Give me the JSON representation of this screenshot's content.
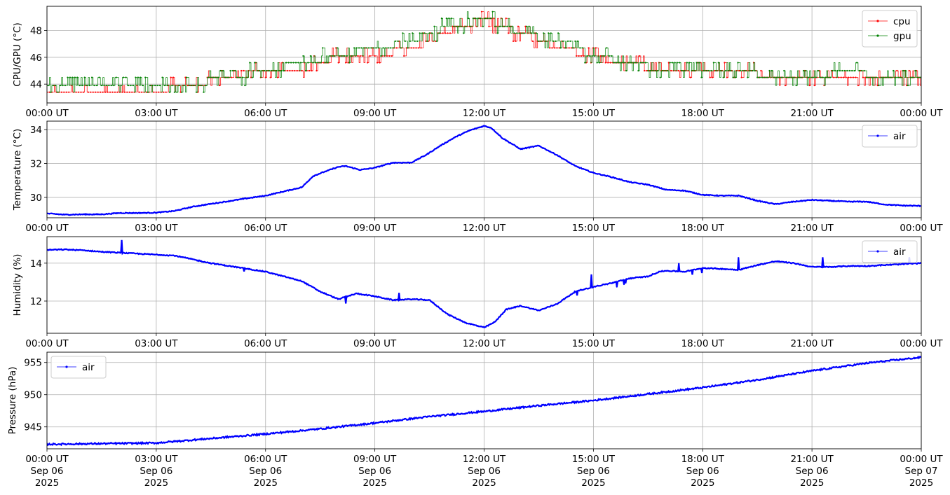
{
  "chart_data": [
    {
      "type": "line",
      "ylabel": "CPU/GPU (°C)",
      "ylim": [
        42.6,
        49.8
      ],
      "yticks": [
        "44",
        "46",
        "48"
      ],
      "xticks": [
        "00:00 UT",
        "03:00 UT",
        "06:00 UT",
        "09:00 UT",
        "12:00 UT",
        "15:00 UT",
        "18:00 UT",
        "21:00 UT",
        "00:00 UT"
      ],
      "grid": true,
      "legend_position": "top-right",
      "x_hours": [
        0,
        1,
        2,
        3,
        4,
        5,
        6,
        7,
        8,
        9,
        10,
        11,
        12,
        13,
        14,
        15,
        16,
        17,
        18,
        19,
        20,
        21,
        22,
        23,
        24
      ],
      "series": [
        {
          "name": "cpu",
          "color": "#ff0000",
          "values": [
            43.4,
            43.4,
            43.5,
            43.5,
            44.0,
            44.5,
            45.0,
            45.0,
            46.1,
            46.1,
            46.7,
            47.8,
            48.8,
            47.8,
            46.7,
            46.1,
            45.5,
            45.0,
            45.0,
            45.0,
            44.5,
            44.5,
            44.5,
            44.5,
            44.5
          ]
        },
        {
          "name": "gpu",
          "color": "#008000",
          "values": [
            44.0,
            44.0,
            44.0,
            44.0,
            44.0,
            44.5,
            45.0,
            45.6,
            46.1,
            46.7,
            47.2,
            48.3,
            48.9,
            47.8,
            47.2,
            46.1,
            45.6,
            45.0,
            45.0,
            45.0,
            44.5,
            44.5,
            45.0,
            44.5,
            44.5
          ]
        }
      ]
    },
    {
      "type": "line",
      "ylabel": "Temperature (°C)",
      "ylim": [
        28.8,
        34.5
      ],
      "yticks": [
        "30",
        "32",
        "34"
      ],
      "xticks": [
        "00:00 UT",
        "03:00 UT",
        "06:00 UT",
        "09:00 UT",
        "12:00 UT",
        "15:00 UT",
        "18:00 UT",
        "21:00 UT",
        "00:00 UT"
      ],
      "grid": true,
      "legend_position": "top-right",
      "series": [
        {
          "name": "air",
          "color": "#0000ff",
          "x_hours": [
            0,
            0.5,
            1,
            1.5,
            2,
            2.5,
            3,
            3.5,
            4,
            4.5,
            5,
            5.5,
            6,
            6.5,
            7,
            7.3,
            7.6,
            8,
            8.2,
            8.6,
            9,
            9.5,
            10,
            10.4,
            10.8,
            11.2,
            11.6,
            12,
            12.2,
            12.5,
            13,
            13.5,
            14,
            14.5,
            15,
            15.5,
            16,
            16.5,
            17,
            17.5,
            18,
            18.5,
            19,
            19.5,
            20,
            20.5,
            21,
            21.5,
            22,
            22.5,
            23,
            23.5,
            24
          ],
          "values": [
            29.05,
            28.98,
            29.0,
            29.0,
            29.08,
            29.08,
            29.1,
            29.2,
            29.45,
            29.62,
            29.78,
            29.95,
            30.1,
            30.35,
            30.6,
            31.25,
            31.5,
            31.8,
            31.85,
            31.62,
            31.75,
            32.05,
            32.05,
            32.5,
            33.05,
            33.55,
            33.95,
            34.22,
            34.1,
            33.5,
            32.85,
            33.05,
            32.5,
            31.85,
            31.45,
            31.2,
            30.9,
            30.75,
            30.45,
            30.4,
            30.15,
            30.1,
            30.1,
            29.8,
            29.6,
            29.75,
            29.85,
            29.8,
            29.75,
            29.75,
            29.58,
            29.52,
            29.5
          ]
        }
      ]
    },
    {
      "type": "line",
      "ylabel": "Humidity (%)",
      "ylim": [
        10.3,
        15.4
      ],
      "yticks": [
        "12",
        "14"
      ],
      "xticks": [
        "00:00 UT",
        "03:00 UT",
        "06:00 UT",
        "09:00 UT",
        "12:00 UT",
        "15:00 UT",
        "18:00 UT",
        "21:00 UT",
        "00:00 UT"
      ],
      "grid": true,
      "legend_position": "top-right",
      "series": [
        {
          "name": "air",
          "color": "#0000ff",
          "x_hours": [
            0,
            0.5,
            1,
            1.5,
            2,
            2.5,
            3,
            3.5,
            4,
            4.5,
            5,
            5.5,
            6,
            6.5,
            7,
            7.5,
            8,
            8.5,
            9,
            9.5,
            10,
            10.5,
            11,
            11.5,
            12,
            12.3,
            12.6,
            13,
            13.5,
            14,
            14.5,
            15,
            15.5,
            16,
            16.5,
            16.8,
            17,
            17.5,
            18,
            18.5,
            19,
            19.5,
            20,
            20.5,
            21,
            21.5,
            22,
            22.5,
            23,
            23.5,
            24
          ],
          "values": [
            14.7,
            14.72,
            14.68,
            14.6,
            14.55,
            14.5,
            14.45,
            14.4,
            14.2,
            14.0,
            13.85,
            13.7,
            13.55,
            13.3,
            13.05,
            12.5,
            12.1,
            12.4,
            12.25,
            12.05,
            12.1,
            12.05,
            11.3,
            10.85,
            10.6,
            10.9,
            11.55,
            11.75,
            11.5,
            11.85,
            12.5,
            12.75,
            12.95,
            13.2,
            13.3,
            13.55,
            13.6,
            13.55,
            13.75,
            13.7,
            13.65,
            13.9,
            14.1,
            14.0,
            13.8,
            13.8,
            13.85,
            13.85,
            13.9,
            13.95,
            14.0
          ]
        }
      ]
    },
    {
      "type": "line",
      "ylabel": "Pressure (hPa)",
      "ylim": [
        941.6,
        956.6
      ],
      "yticks": [
        "945",
        "950",
        "955"
      ],
      "xticks": [
        "00:00 UT",
        "03:00 UT",
        "06:00 UT",
        "09:00 UT",
        "12:00 UT",
        "15:00 UT",
        "18:00 UT",
        "21:00 UT",
        "00:00 UT"
      ],
      "xticks_line2": [
        "Sep 06",
        "Sep 06",
        "Sep 06",
        "Sep 06",
        "Sep 06",
        "Sep 06",
        "Sep 06",
        "Sep 06",
        "Sep 07"
      ],
      "xticks_line3": [
        "2025",
        "2025",
        "2025",
        "2025",
        "2025",
        "2025",
        "2025",
        "2025",
        "2025"
      ],
      "grid": true,
      "legend_position": "top-left",
      "series": [
        {
          "name": "air",
          "color": "#0000ff",
          "x_hours": [
            0,
            1.5,
            3,
            4.5,
            6,
            7.5,
            9,
            10.5,
            12,
            13.5,
            15,
            16.5,
            18,
            19.5,
            21,
            22.5,
            24
          ],
          "values": [
            942.3,
            942.4,
            942.5,
            943.2,
            943.9,
            944.7,
            945.6,
            946.6,
            947.4,
            948.3,
            949.1,
            950.1,
            951.1,
            952.3,
            953.7,
            954.9,
            955.8
          ]
        }
      ]
    }
  ]
}
